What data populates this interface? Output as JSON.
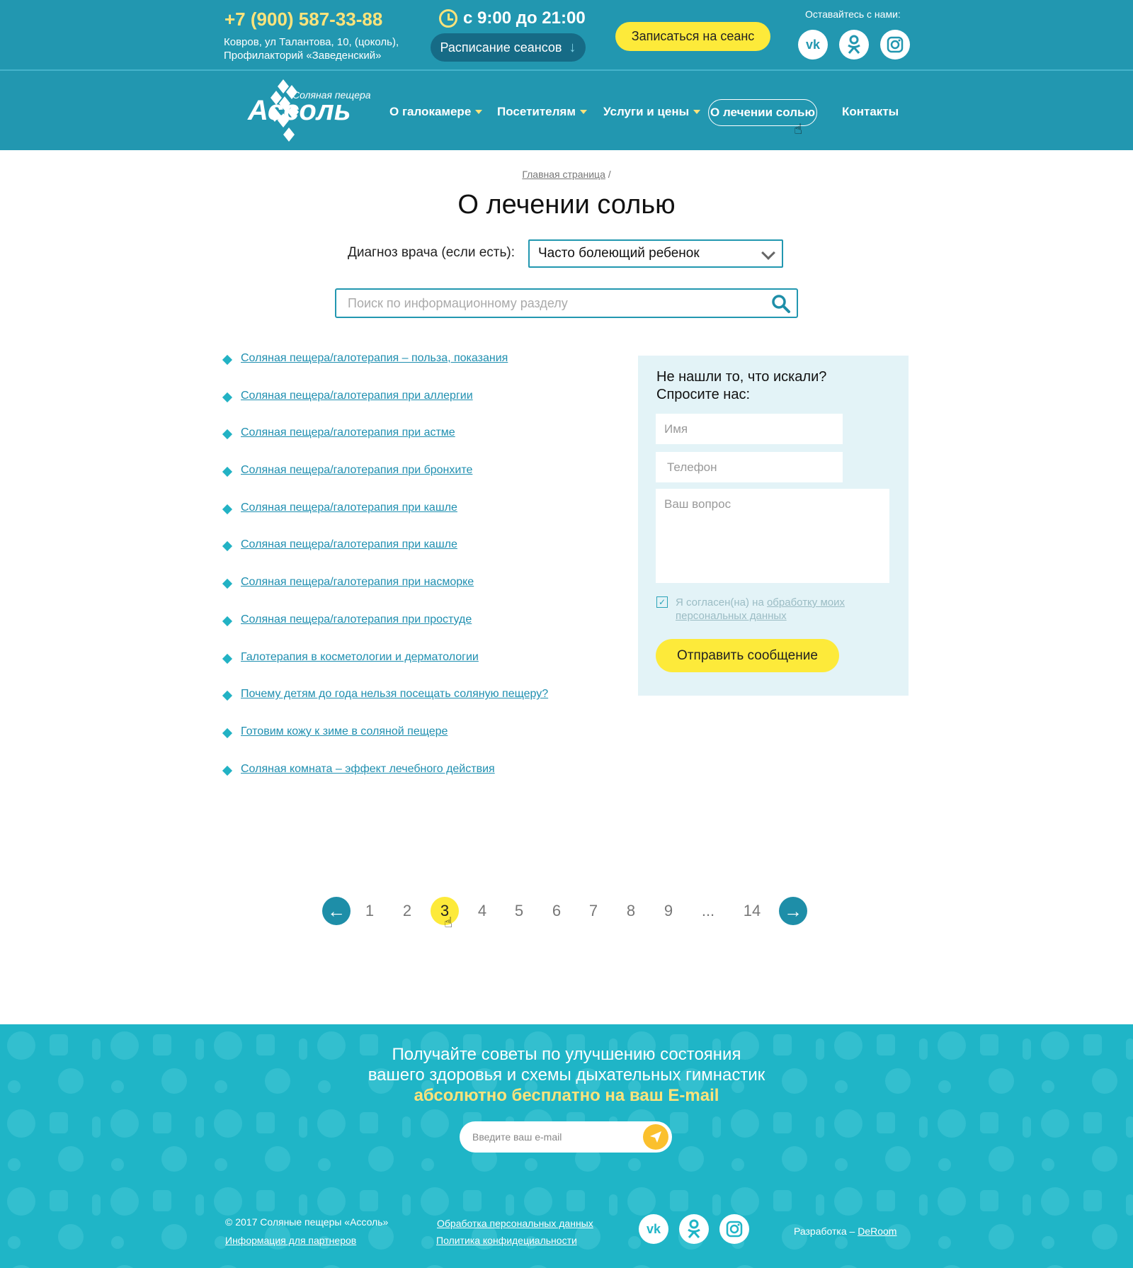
{
  "header": {
    "phone": "+7 (900) 587-33-88",
    "address_line1": "Ковров, ул Талантова, 10, (цоколь),",
    "address_line2": "Профилакторий «Заведенский»",
    "hours": "с 9:00 до 21:00",
    "schedule_label": "Расписание сеансов",
    "book_label": "Записаться на сеанс",
    "stay_label": "Оставайтесь с нами:",
    "social": [
      "vk-icon",
      "odnoklassniki-icon",
      "instagram-icon"
    ]
  },
  "logo": {
    "subtitle": "Соляная пещера",
    "title": "Ассоль"
  },
  "nav": {
    "items": [
      {
        "label": "О галокамере"
      },
      {
        "label": "Посетителям"
      },
      {
        "label": "Услуги и цены"
      },
      {
        "label": "О лечении солью"
      },
      {
        "label": "Контакты"
      }
    ]
  },
  "breadcrumb": {
    "home": "Главная страница",
    "sep": "/"
  },
  "page": {
    "title": "О лечении солью"
  },
  "filter": {
    "diagnosis_label": "Диагноз врача (если есть):",
    "diagnosis_value": "Часто болеющий ребенок",
    "search_placeholder": "Поиск по информационному разделу"
  },
  "articles": [
    "Соляная пещера/галотерапия – польза, показания",
    "Соляная пещера/галотерапия при аллергии",
    "Соляная пещера/галотерапия при астме",
    "Соляная пещера/галотерапия при бронхите",
    "Соляная пещера/галотерапия при кашле",
    "Соляная пещера/галотерапия при кашле",
    "Соляная пещера/галотерапия при насморке",
    "Соляная пещера/галотерапия при простуде",
    "Галотерапия в косметологии и дерматологии",
    "Почему детям до года нельзя посещать соляную пещеру?",
    "Готовим кожу к зиме в соляной пещере",
    "Соляная комната – эффект лечебного действия"
  ],
  "ask": {
    "title1": "Не нашли то, что искали?",
    "title2": "Спросите нас:",
    "name_placeholder": "Имя",
    "phone_placeholder": "Телефон",
    "question_placeholder": "Ваш вопрос",
    "consent_prefix": "Я согласен(на) на",
    "consent_link": "обработку моих персональных данных",
    "send_label": "Отправить сообщение"
  },
  "pagination": {
    "pages": [
      "1",
      "2",
      "3",
      "4",
      "5",
      "6",
      "7",
      "8",
      "9",
      "...",
      "14"
    ],
    "current": "3"
  },
  "footer": {
    "promo1": "Получайте советы по улучшению состояния",
    "promo2": "вашего здоровья и схемы дыхательных гимнастик",
    "promo3": "абсолютно бесплатно на ваш E-mail",
    "email_placeholder": "Введите ваш e-mail",
    "copyright": "© 2017 Соляные пещеры  «Ассоль»",
    "partners": "Информация для партнеров",
    "personal_data": "Обработка персональных данных",
    "privacy": "Политика конфидециальности",
    "dev_prefix": "Разработка –",
    "dev_name": "DeRoom"
  },
  "colors": {
    "header_bg": "#2297b0",
    "accent_yellow": "#fdea3a",
    "link": "#1f8fb0",
    "footer_bg": "#1fb5c7",
    "form_bg": "#e3f3f7"
  }
}
